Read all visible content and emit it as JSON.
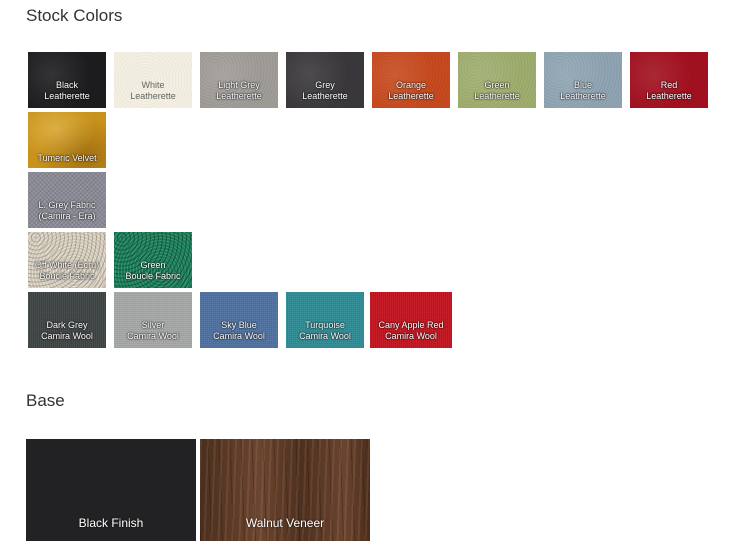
{
  "stock_colors": {
    "title": "Stock Colors",
    "swatches": [
      {
        "label": "Black\nLeatherette",
        "color": "#1d1d1f",
        "texture": "leather"
      },
      {
        "label": "White\nLeatherette",
        "color": "#f3efe2",
        "texture": "leather-light"
      },
      {
        "label": "Light Grey\nLeatherette",
        "color": "#a09c98",
        "texture": "leather"
      },
      {
        "label": "Grey\nLeatherette",
        "color": "#3a383c",
        "texture": "leather"
      },
      {
        "label": "Orange\nLeatherette",
        "color": "#c84a1e",
        "texture": "leather"
      },
      {
        "label": "Green\nLeatherette",
        "color": "#9fae6e",
        "texture": "leather"
      },
      {
        "label": "Blue\nLeatherette",
        "color": "#8fa5b3",
        "texture": "leather"
      },
      {
        "label": "Red\nLeatherette",
        "color": "#a3101f",
        "texture": "leather"
      },
      {
        "label": "Tumeric Velvet",
        "color": "#c9921c",
        "texture": "velvet"
      },
      {
        "label": "L. Grey Fabric\n(Camira - Era)",
        "color": "#8a8a96",
        "texture": "fabric"
      },
      {
        "label": "Off White (Ecru)\nBoucle Fabric",
        "color": "#cfc6b6",
        "texture": "boucle"
      },
      {
        "label": "Green\nBoucle Fabric",
        "color": "#1c7a5a",
        "texture": "boucle-dark"
      },
      {
        "label": "Dark Grey\nCamira Wool",
        "color": "#3f4444",
        "texture": "wool"
      },
      {
        "label": "Silver\nCamira Wool",
        "color": "#a7a8a8",
        "texture": "wool"
      },
      {
        "label": "Sky Blue\nCamira Wool",
        "color": "#4f72a0",
        "texture": "wool"
      },
      {
        "label": "Turquoise\nCamira Wool",
        "color": "#2f8c96",
        "texture": "wool"
      },
      {
        "label": "Cany Apple Red\nCamira Wool",
        "color": "#c4141f",
        "texture": "wool"
      }
    ]
  },
  "base": {
    "title": "Base",
    "swatches": [
      {
        "label": "Black Finish",
        "color": "#222224",
        "texture": "solid"
      },
      {
        "label": "Walnut Veneer",
        "color": "#5a3a26",
        "texture": "wood"
      }
    ]
  }
}
